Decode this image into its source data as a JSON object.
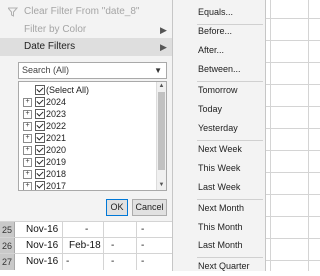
{
  "filter_menu": {
    "clear_filter": "Clear Filter From \"date_8\"",
    "filter_by_color": "Filter by Color",
    "date_filters": "Date Filters",
    "search_placeholder": "Search (All)",
    "select_all": "(Select All)",
    "years": [
      "2024",
      "2023",
      "2022",
      "2021",
      "2020",
      "2019",
      "2018",
      "2017"
    ],
    "ok": "OK",
    "cancel": "Cancel"
  },
  "date_submenu": {
    "items": [
      "Equals...",
      "Before...",
      "After...",
      "Between...",
      "Tomorrow",
      "Today",
      "Yesterday",
      "Next Week",
      "This Week",
      "Last Week",
      "Next Month",
      "This Month",
      "Last Month",
      "Next Quarter"
    ]
  },
  "sheet": {
    "rows": [
      {
        "num": "25",
        "a": "Nov-16",
        "b": "",
        "c": "-",
        "d": "-"
      },
      {
        "num": "26",
        "a": "Nov-16",
        "b": "Feb-18",
        "c": "-",
        "d": "-"
      },
      {
        "num": "27",
        "a": "Nov-16",
        "b": "-",
        "c": "-",
        "d": "-"
      }
    ]
  }
}
